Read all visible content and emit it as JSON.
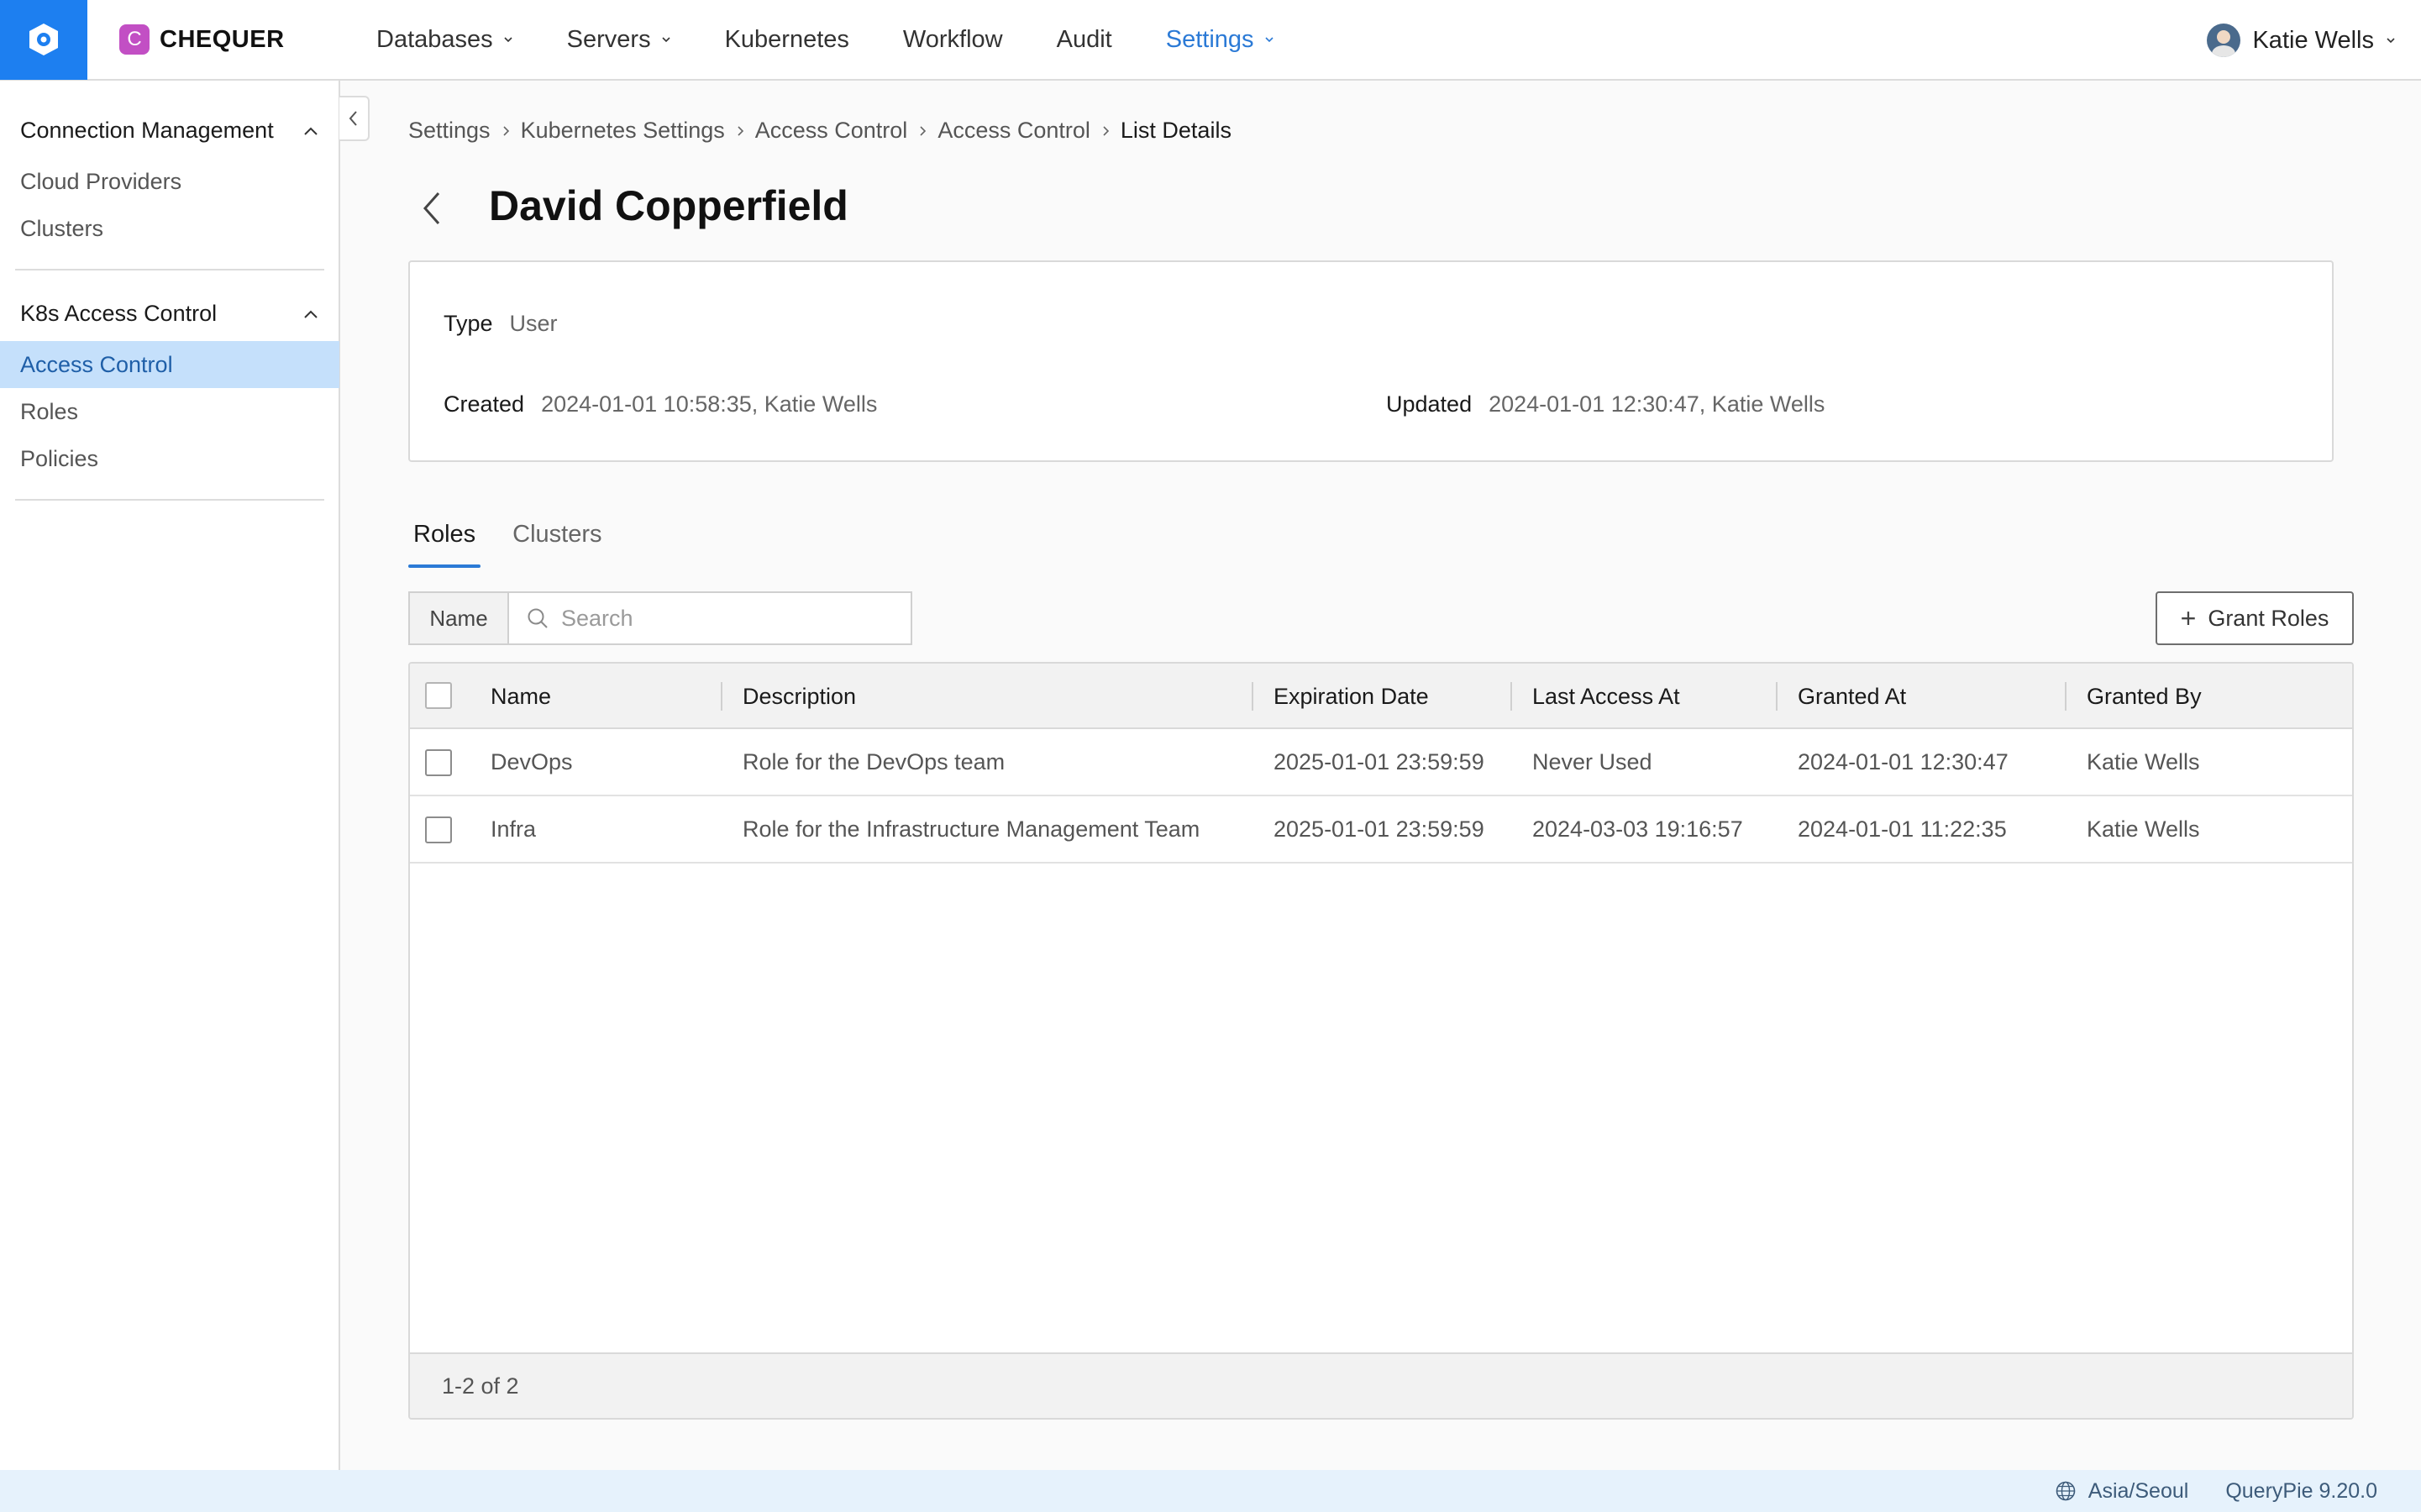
{
  "app": {
    "brand": "CHEQUER",
    "brand_initial": "C",
    "accent_color": "#1d7ff0"
  },
  "nav": {
    "items": [
      {
        "label": "Databases",
        "has_dropdown": true,
        "active": false
      },
      {
        "label": "Servers",
        "has_dropdown": true,
        "active": false
      },
      {
        "label": "Kubernetes",
        "has_dropdown": false,
        "active": false
      },
      {
        "label": "Workflow",
        "has_dropdown": false,
        "active": false
      },
      {
        "label": "Audit",
        "has_dropdown": false,
        "active": false
      },
      {
        "label": "Settings",
        "has_dropdown": true,
        "active": true
      }
    ],
    "user_name": "Katie Wells"
  },
  "sidebar": {
    "groups": [
      {
        "title": "Connection Management",
        "items": [
          "Cloud Providers",
          "Clusters"
        ]
      },
      {
        "title": "K8s Access Control",
        "items": [
          "Access Control",
          "Roles",
          "Policies"
        ],
        "active_item": "Access Control"
      }
    ]
  },
  "breadcrumb": [
    "Settings",
    "Kubernetes Settings",
    "Access Control",
    "Access Control",
    "List Details"
  ],
  "page": {
    "title": "David Copperfield"
  },
  "info": {
    "type_label": "Type",
    "type_value": "User",
    "created_label": "Created",
    "created_value": "2024-01-01 10:58:35, Katie Wells",
    "updated_label": "Updated",
    "updated_value": "2024-01-01 12:30:47, Katie Wells"
  },
  "tabs": [
    {
      "label": "Roles",
      "active": true
    },
    {
      "label": "Clusters",
      "active": false
    }
  ],
  "filter": {
    "label": "Name",
    "placeholder": "Search",
    "value": ""
  },
  "actions": {
    "grant_roles": "Grant Roles"
  },
  "table": {
    "columns": [
      "Name",
      "Description",
      "Expiration Date",
      "Last Access At",
      "Granted At",
      "Granted By"
    ],
    "rows": [
      [
        "DevOps",
        "Role for the DevOps team",
        "2025-01-01 23:59:59",
        "Never Used",
        "2024-01-01 12:30:47",
        "Katie Wells"
      ],
      [
        "Infra",
        "Role for the Infrastructure Management Team",
        "2025-01-01 23:59:59",
        "2024-03-03 19:16:57",
        "2024-01-01 11:22:35",
        "Katie Wells"
      ]
    ],
    "pagination": "1-2 of 2"
  },
  "footer": {
    "timezone": "Asia/Seoul",
    "version": "QueryPie 9.20.0"
  }
}
